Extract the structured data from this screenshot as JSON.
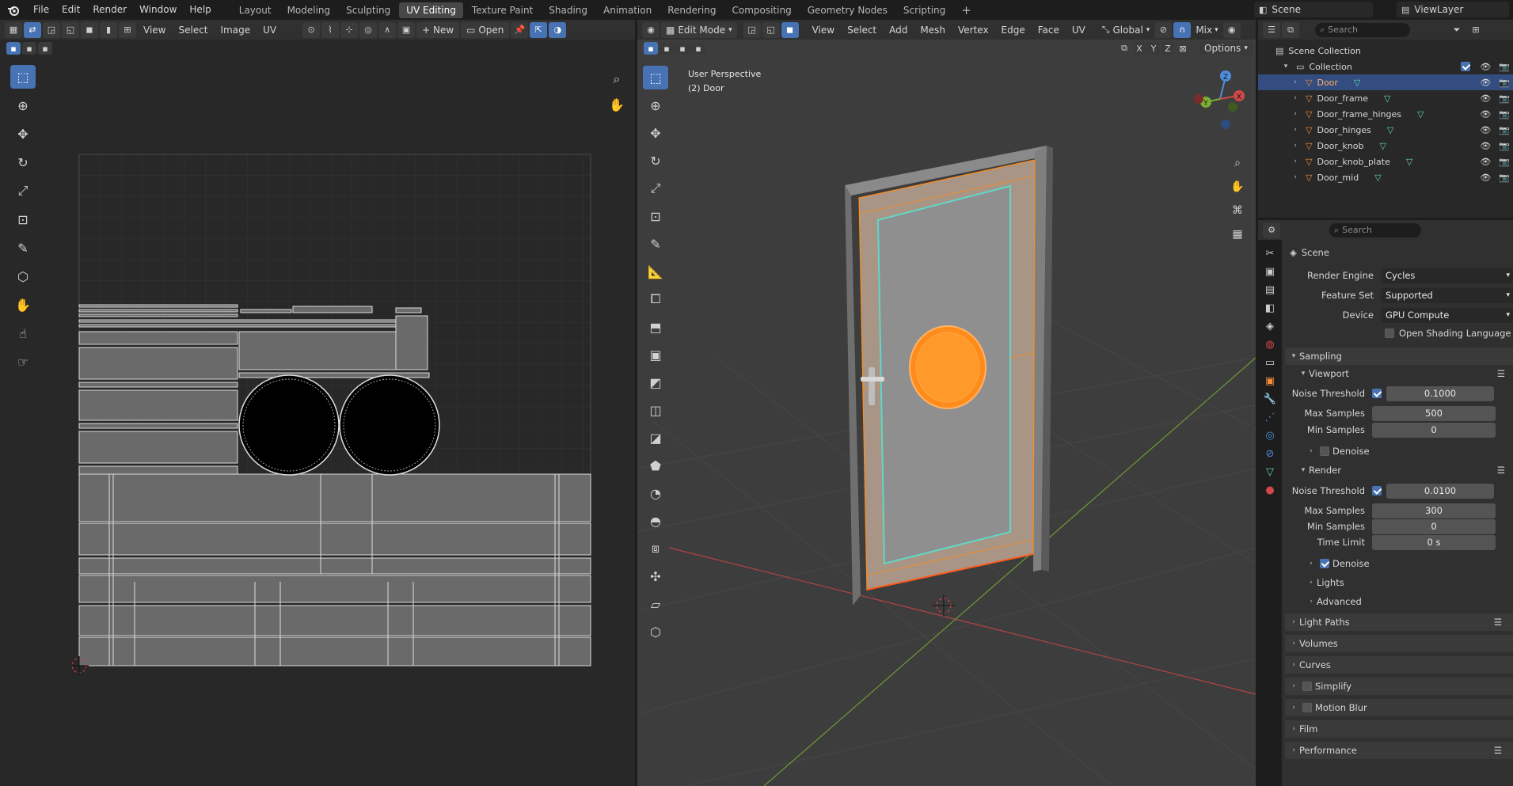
{
  "topbar": {
    "menus": [
      "File",
      "Edit",
      "Render",
      "Window",
      "Help"
    ],
    "workspaces": [
      "Layout",
      "Modeling",
      "Sculpting",
      "UV Editing",
      "Texture Paint",
      "Shading",
      "Animation",
      "Rendering",
      "Compositing",
      "Geometry Nodes",
      "Scripting"
    ],
    "active_workspace": "UV Editing",
    "scene_name": "Scene",
    "view_layer_name": "ViewLayer"
  },
  "uv_editor": {
    "menus": [
      "View",
      "Select",
      "Image",
      "UV"
    ],
    "new_label": "New",
    "open_label": "Open"
  },
  "viewport": {
    "mode": "Edit Mode",
    "menus": [
      "View",
      "Select",
      "Add",
      "Mesh",
      "Vertex",
      "Edge",
      "Face",
      "UV"
    ],
    "orientation": "Global",
    "shading_mix": "Mix",
    "options_label": "Options",
    "axes": [
      "X",
      "Y",
      "Z"
    ],
    "overlay_title": "User Perspective",
    "overlay_object": "(2) Door"
  },
  "outliner": {
    "search_placeholder": "Search",
    "scene_collection": "Scene Collection",
    "collection": "Collection",
    "objects": [
      "Door",
      "Door_frame",
      "Door_frame_hinges",
      "Door_hinges",
      "Door_knob",
      "Door_knob_plate",
      "Door_mid"
    ],
    "selected": "Door"
  },
  "properties": {
    "search_placeholder": "Search",
    "context": "Scene",
    "render_engine_label": "Render Engine",
    "render_engine": "Cycles",
    "feature_set_label": "Feature Set",
    "feature_set": "Supported",
    "device_label": "Device",
    "device": "GPU Compute",
    "osl_label": "Open Shading Language",
    "sampling": "Sampling",
    "viewport_label": "Viewport",
    "render_label": "Render",
    "noise_threshold_label": "Noise Threshold",
    "max_samples_label": "Max Samples",
    "min_samples_label": "Min Samples",
    "time_limit_label": "Time Limit",
    "denoise_label": "Denoise",
    "viewport_noise_threshold": "0.1000",
    "viewport_max_samples": "500",
    "viewport_min_samples": "0",
    "render_noise_threshold": "0.0100",
    "render_max_samples": "300",
    "render_min_samples": "0",
    "render_time_limit": "0 s",
    "subpanels": [
      "Lights",
      "Advanced"
    ],
    "panels": [
      "Light Paths",
      "Volumes",
      "Curves",
      "Simplify",
      "Motion Blur",
      "Film",
      "Performance"
    ]
  },
  "colors": {
    "accent": "#4772b3",
    "selection_orange": "#ff8c1a",
    "uv_background": "#282828"
  }
}
